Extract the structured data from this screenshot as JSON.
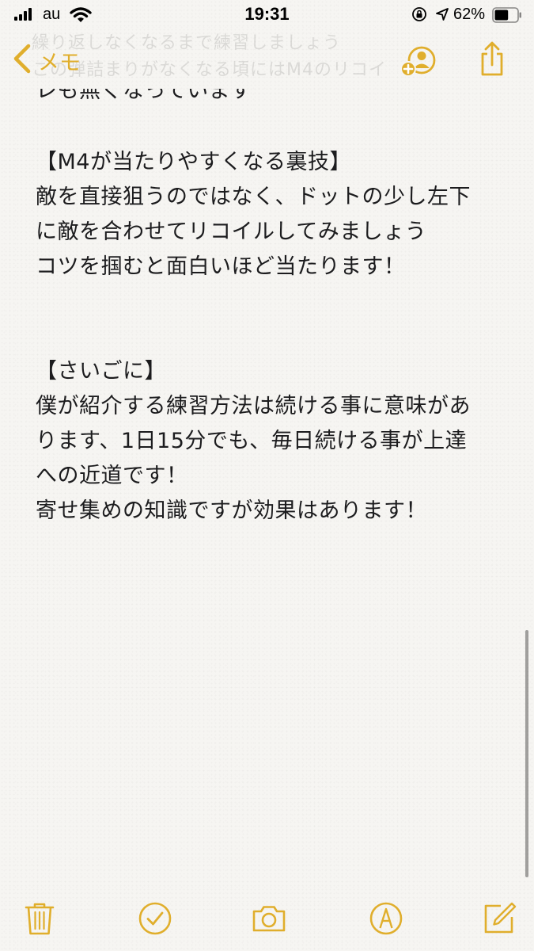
{
  "status_bar": {
    "carrier": "au",
    "time": "19:31",
    "battery_percent": "62%",
    "battery_level": 0.62
  },
  "nav": {
    "back_label": "メモ",
    "ghost_line_1": "繰り返しなくなるまで練習しましょう",
    "ghost_line_2": "この弾詰まりがなくなる頃にはM4のリコイ"
  },
  "note": {
    "lines": [
      "レも無くなっています",
      "",
      "【M4が当たりやすくなる裏技】",
      "敵を直接狙うのではなく、ドットの少し左下",
      "に敵を合わせてリコイルしてみましょう",
      "コツを掴むと面白いほど当たります！",
      "",
      "",
      "【さいごに】",
      "僕が紹介する練習方法は続ける事に意味があ",
      "ります、1日15分でも、毎日続ける事が上達",
      "への近道です！",
      "寄せ集めの知識ですが効果はあります！"
    ]
  },
  "toolbar": {
    "icons": [
      "trash-icon",
      "checklist-icon",
      "camera-icon",
      "markup-icon",
      "compose-icon"
    ]
  },
  "colors": {
    "accent": "#e0ae2c",
    "paper": "#f6f5f2",
    "text": "#1c1c1e"
  }
}
